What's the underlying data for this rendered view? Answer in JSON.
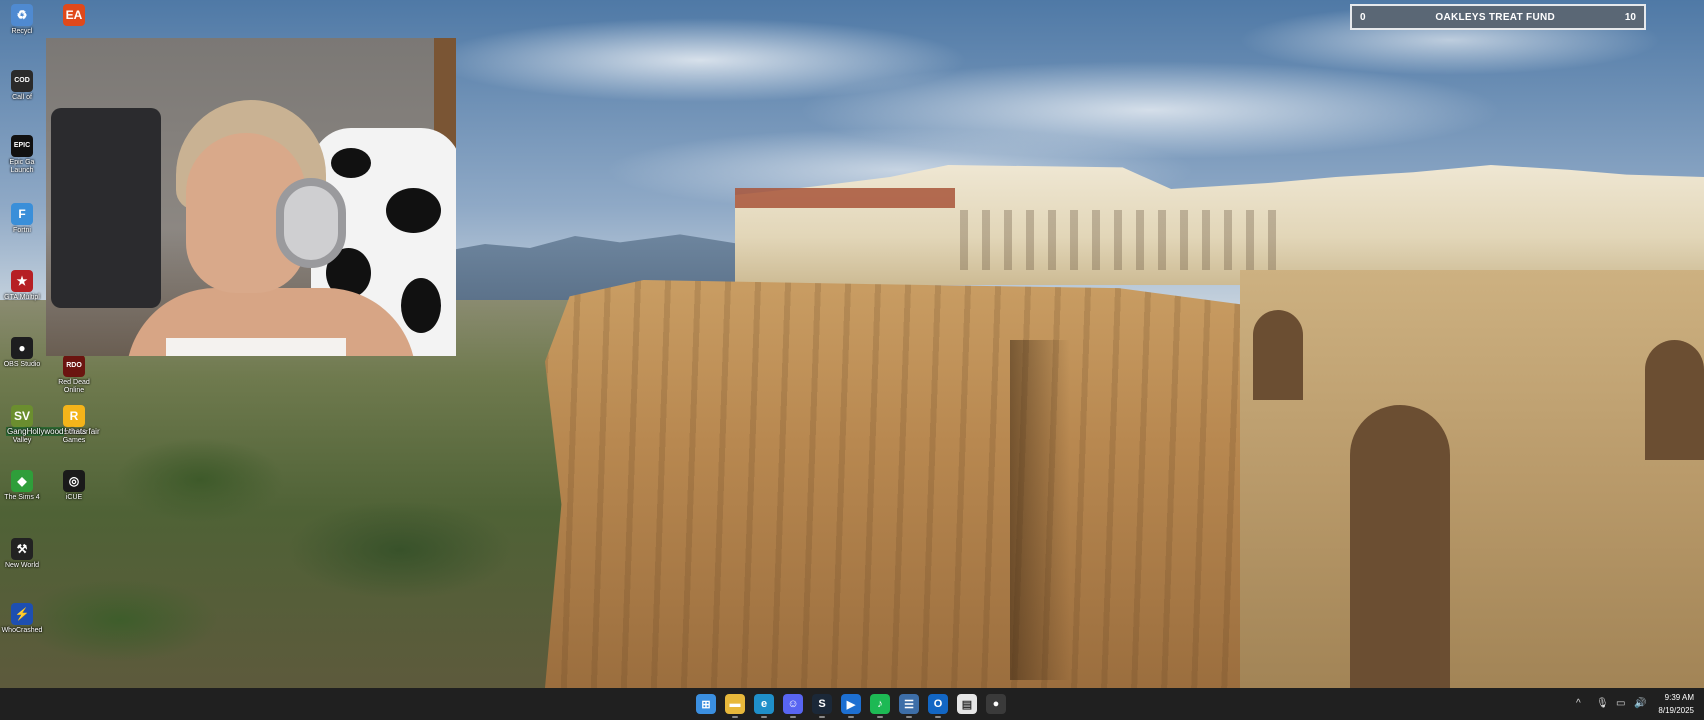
{
  "goal": {
    "title": "OAKLEYS TREAT FUND",
    "current": "0",
    "target": "10"
  },
  "desktop_icons": [
    {
      "id": "recycle-bin",
      "label": "Recycl",
      "glyph": "♻",
      "color": "#4f8ad1"
    },
    {
      "id": "ea",
      "label": "",
      "glyph": "EA",
      "color": "#e0491b"
    },
    {
      "id": "call-of-duty",
      "label": "Call of",
      "glyph": "COD",
      "color": "#2a2a2a"
    },
    {
      "id": "epic-games",
      "label": "Epic Ga Launch",
      "glyph": "EPIC",
      "color": "#111111"
    },
    {
      "id": "fortnite",
      "label": "Fortni",
      "glyph": "F",
      "color": "#3a8fd9"
    },
    {
      "id": "gta",
      "label": "GTA Multipl",
      "glyph": "★",
      "color": "#b61f24"
    },
    {
      "id": "obs-studio",
      "label": "OBS Studio",
      "glyph": "●",
      "color": "#1d1d1f"
    },
    {
      "id": "red-dead-online",
      "label": "Red Dead Online",
      "glyph": "RDO",
      "color": "#6b1410"
    },
    {
      "id": "stardew-valley",
      "label": "Stardew Valley",
      "glyph": "SV",
      "color": "#6b8e2f"
    },
    {
      "id": "rockstar",
      "label": "Rockstar Games",
      "glyph": "R",
      "color": "#f4b41a"
    },
    {
      "id": "sims-4",
      "label": "The Sims 4",
      "glyph": "◆",
      "color": "#2f9e3a"
    },
    {
      "id": "icue",
      "label": "iCUE",
      "glyph": "◎",
      "color": "#1a1a1a"
    },
    {
      "id": "new-world",
      "label": "New World",
      "glyph": "⚒",
      "color": "#222222"
    },
    {
      "id": "whocrashed",
      "label": "WhoCrashed",
      "glyph": "⚡",
      "color": "#1e4fb0"
    }
  ],
  "overlay_text": {
    "highlight": "GangHollywood",
    "suffix": "! thats fair"
  },
  "taskbar": {
    "icons": [
      {
        "id": "start",
        "glyph": "⊞",
        "color": "#3b8fe0"
      },
      {
        "id": "file-explorer",
        "glyph": "▬",
        "color": "#e8b83b"
      },
      {
        "id": "edge",
        "glyph": "e",
        "color": "#1f8fc9"
      },
      {
        "id": "discord",
        "glyph": "☺",
        "color": "#5865f2"
      },
      {
        "id": "steam",
        "glyph": "S",
        "color": "#1b2838"
      },
      {
        "id": "media-player",
        "glyph": "▶",
        "color": "#1d6fd1"
      },
      {
        "id": "spotify",
        "glyph": "♪",
        "color": "#1db954"
      },
      {
        "id": "task-app",
        "glyph": "☰",
        "color": "#3d6ea8"
      },
      {
        "id": "outlook",
        "glyph": "O",
        "color": "#1266c4"
      },
      {
        "id": "notepad",
        "glyph": "▤",
        "color": "#e6e6e6"
      },
      {
        "id": "obs",
        "glyph": "●",
        "color": "#3a3a3a"
      }
    ],
    "tray": {
      "chevron": "^",
      "mic": "🎙",
      "network": "▭",
      "volume": "🔊"
    },
    "clock": {
      "time": "9:39 AM",
      "date": "8/19/2025"
    }
  }
}
